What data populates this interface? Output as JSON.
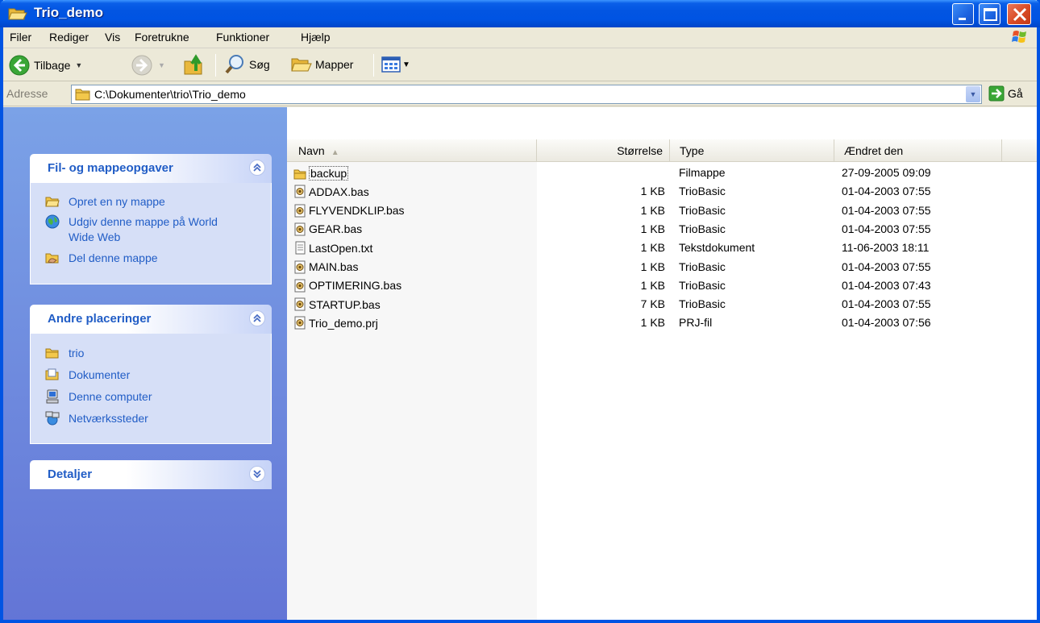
{
  "window": {
    "title": "Trio_demo"
  },
  "menu": {
    "items": [
      "Filer",
      "Rediger",
      "Vis",
      "Foretrukne",
      "Funktioner",
      "Hjælp"
    ]
  },
  "toolbar": {
    "back_label": "Tilbage",
    "search_label": "Søg",
    "folders_label": "Mapper"
  },
  "address": {
    "label": "Adresse",
    "path": "C:\\Dokumenter\\trio\\Trio_demo",
    "go_label": "Gå"
  },
  "taskpane": {
    "file_tasks": {
      "title": "Fil- og mappeopgaver",
      "items": [
        {
          "label": "Opret en ny mappe",
          "icon": "new-folder-icon"
        },
        {
          "label": "Udgiv denne mappe på World Wide Web",
          "icon": "publish-web-icon"
        },
        {
          "label": "Del denne mappe",
          "icon": "share-folder-icon"
        }
      ]
    },
    "other_places": {
      "title": "Andre placeringer",
      "items": [
        {
          "label": "trio",
          "icon": "folder-icon"
        },
        {
          "label": "Dokumenter",
          "icon": "documents-icon"
        },
        {
          "label": "Denne computer",
          "icon": "computer-icon"
        },
        {
          "label": "Netværkssteder",
          "icon": "network-icon"
        }
      ]
    },
    "details": {
      "title": "Detaljer"
    }
  },
  "filelist": {
    "columns": [
      "Navn",
      "Størrelse",
      "Type",
      "Ændret den"
    ],
    "files": [
      {
        "name": "backup",
        "size": "",
        "type": "Filmappe",
        "modified": "27-09-2005 09:09",
        "icon": "folder-icon"
      },
      {
        "name": "ADDAX.bas",
        "size": "1 KB",
        "type": "TrioBasic",
        "modified": "01-04-2003 07:55",
        "icon": "triobasic-file-icon"
      },
      {
        "name": "FLYVENDKLIP.bas",
        "size": "1 KB",
        "type": "TrioBasic",
        "modified": "01-04-2003 07:55",
        "icon": "triobasic-file-icon"
      },
      {
        "name": "GEAR.bas",
        "size": "1 KB",
        "type": "TrioBasic",
        "modified": "01-04-2003 07:55",
        "icon": "triobasic-file-icon"
      },
      {
        "name": "LastOpen.txt",
        "size": "1 KB",
        "type": "Tekstdokument",
        "modified": "11-06-2003 18:11",
        "icon": "text-file-icon"
      },
      {
        "name": "MAIN.bas",
        "size": "1 KB",
        "type": "TrioBasic",
        "modified": "01-04-2003 07:55",
        "icon": "triobasic-file-icon"
      },
      {
        "name": "OPTIMERING.bas",
        "size": "1 KB",
        "type": "TrioBasic",
        "modified": "01-04-2003 07:43",
        "icon": "triobasic-file-icon"
      },
      {
        "name": "STARTUP.bas",
        "size": "7 KB",
        "type": "TrioBasic",
        "modified": "01-04-2003 07:55",
        "icon": "triobasic-file-icon"
      },
      {
        "name": "Trio_demo.prj",
        "size": "1 KB",
        "type": "PRJ-fil",
        "modified": "01-04-2003 07:56",
        "icon": "triobasic-file-icon"
      }
    ]
  }
}
